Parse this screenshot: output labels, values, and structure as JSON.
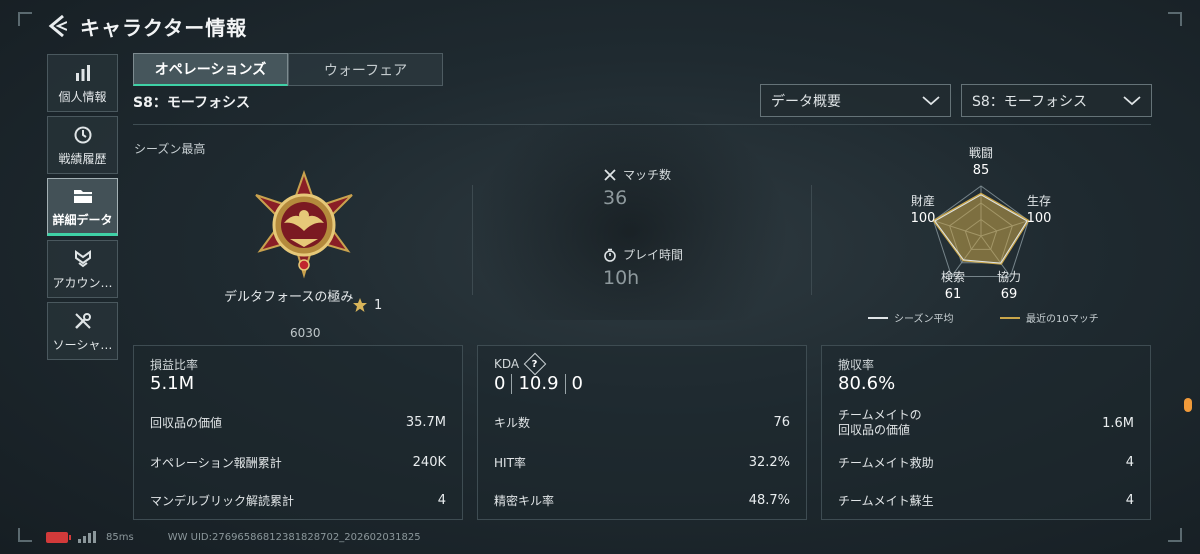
{
  "header": {
    "title": "キャラクター情報"
  },
  "sidebar": {
    "items": [
      {
        "label": "個人情報",
        "icon": "bar-chart-icon"
      },
      {
        "label": "戦績履歴",
        "icon": "history-clock-icon"
      },
      {
        "label": "詳細データ",
        "icon": "folder-icon",
        "active": true
      },
      {
        "label": "アカウン…",
        "icon": "account-badge-icon"
      },
      {
        "label": "ソーシャ…",
        "icon": "wrench-tools-icon"
      }
    ]
  },
  "tabs": [
    {
      "label": "オペレーションズ",
      "active": true
    },
    {
      "label": "ウォーフェア",
      "active": false
    }
  ],
  "season_heading": "S8：モーフォシス",
  "filters": {
    "data_type": "データ概要",
    "season": "S8：モーフォシス"
  },
  "season_best": {
    "label": "シーズン最高",
    "rank_name": "デルタフォースの極み",
    "stars": "1",
    "score": "6030"
  },
  "match": {
    "matches_label": "マッチ数",
    "matches_value": "36",
    "playtime_label": "プレイ時間",
    "playtime_value": "10h"
  },
  "radar": {
    "labels": {
      "combat": "戦闘",
      "survival": "生存",
      "cooperation": "協力",
      "search": "検索",
      "wealth": "財産"
    },
    "values": {
      "combat": 85,
      "survival": 100,
      "cooperation": 69,
      "search": 61,
      "wealth": 100
    },
    "legend": {
      "season_avg": "シーズン平均",
      "recent": "最近の10マッチ"
    },
    "colors": {
      "season_avg": "#dfe4e6",
      "recent": "#c9a64a"
    }
  },
  "panels": {
    "profit": {
      "title": "損益比率",
      "value": "5.1M",
      "rows": [
        {
          "label": "回収品の価値",
          "value": "35.7M"
        },
        {
          "label": "オペレーション報酬累計",
          "value": "240K"
        },
        {
          "label": "マンデルブリック解読累計",
          "value": "4"
        }
      ]
    },
    "kda": {
      "title": "KDA",
      "help": "?",
      "k": "0",
      "d": "10.9",
      "a": "0",
      "rows": [
        {
          "label": "キル数",
          "value": "76"
        },
        {
          "label": "HIT率",
          "value": "32.2%"
        },
        {
          "label": "精密キル率",
          "value": "48.7%"
        }
      ]
    },
    "extract": {
      "title": "撤収率",
      "value": "80.6%",
      "rows": [
        {
          "label_line1": "チームメイトの",
          "label_line2": "回収品の価値",
          "value": "1.6M"
        },
        {
          "label": "チームメイト救助",
          "value": "4"
        },
        {
          "label": "チームメイト蘇生",
          "value": "4"
        }
      ]
    }
  },
  "footer": {
    "ping": "85ms",
    "uid": "WW UID:276965868123818287​02_202602031825"
  }
}
